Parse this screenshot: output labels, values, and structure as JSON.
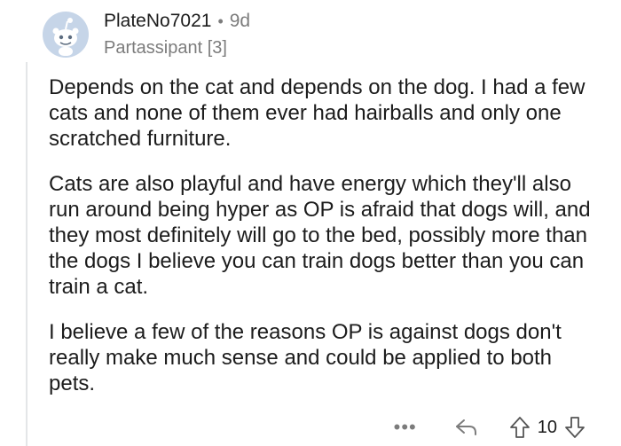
{
  "comment": {
    "author": "PlateNo7021",
    "separator": "•",
    "age": "9d",
    "flair": "Partassipant [3]",
    "paragraphs": [
      "Depends on the cat and depends on the dog. I had a few cats and none of them ever had hairballs and only one scratched furniture.",
      "Cats are also playful and have energy which they'll also run around being hyper as OP is afraid that dogs will, and they most definitely will go to the bed, possibly more than the dogs I believe you can train dogs better than you can train a cat.",
      "I believe a few of the reasons OP is against dogs don't really make much sense and could be applied to both pets."
    ],
    "score": "10"
  },
  "actions": {
    "more_label": "•••"
  },
  "icons": {
    "avatar": "reddit-snoo-avatar",
    "reply": "reply-arrow-icon",
    "upvote": "upvote-arrow-icon",
    "downvote": "downvote-arrow-icon"
  },
  "colors": {
    "avatar_bg": "#c6d5e8",
    "meta_gray": "#7c7c7c",
    "text": "#1c1c1c"
  }
}
